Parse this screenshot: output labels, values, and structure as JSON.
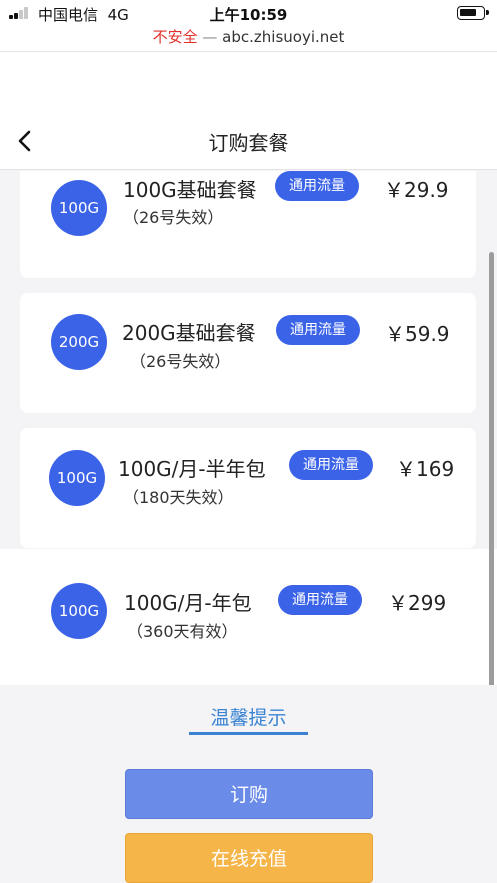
{
  "status_bar": {
    "carrier": "中国电信",
    "network": "4G",
    "time": "上午10:59"
  },
  "url_bar": {
    "security": "不安全",
    "separator": "—",
    "domain": "abc.zhisuoyi.net"
  },
  "header": {
    "title": "订购套餐",
    "back_icon": "chevron-left-icon"
  },
  "packages": [
    {
      "badge": "100G",
      "name": "100G基础套餐",
      "sub": "（26号失效）",
      "tag": "通用流量",
      "price": "￥29.9"
    },
    {
      "badge": "200G",
      "name": "200G基础套餐",
      "sub": "（26号失效）",
      "tag": "通用流量",
      "price": "￥59.9"
    },
    {
      "badge": "100G",
      "name": "100G/月-半年包",
      "sub": "（180天失效）",
      "tag": "通用流量",
      "price": "￥169"
    },
    {
      "badge": "100G",
      "name": "100G/月-年包",
      "sub": "（360天有效）",
      "tag": "通用流量",
      "price": "￥299"
    }
  ],
  "tips": {
    "label": "温馨提示"
  },
  "actions": {
    "order": "订购",
    "recharge": "在线充值"
  },
  "colors": {
    "accent": "#3b63e8",
    "link": "#3a83d2",
    "order_button": "#6b8be8",
    "recharge_button": "#f5b548",
    "insecure": "#e0322b"
  }
}
